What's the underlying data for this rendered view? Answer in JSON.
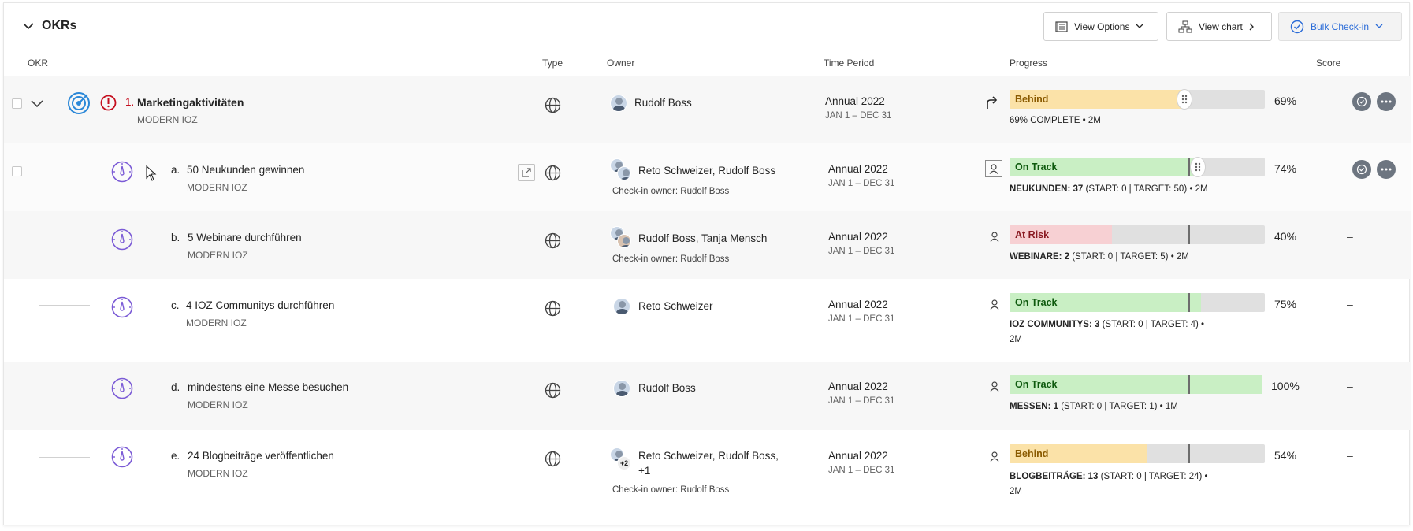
{
  "header": {
    "title": "OKRs",
    "view_options": "View Options",
    "view_chart": "View chart",
    "bulk_checkin": "Bulk Check-in"
  },
  "columns": {
    "okr": "OKR",
    "type": "Type",
    "owner": "Owner",
    "time_period": "Time Period",
    "progress": "Progress",
    "score": "Score"
  },
  "objective": {
    "index": "1.",
    "title": "Marketingaktivitäten",
    "team": "MODERN IOZ",
    "owner": "Rudolf Boss",
    "period": "Annual 2022",
    "range": "JAN 1 – DEC 31",
    "status": "Behind",
    "progress": 69,
    "percent": "69%",
    "meta": "69% COMPLETE • 2M",
    "score": "–",
    "status_color": "#fbe2a8"
  },
  "key_results": [
    {
      "letter": "a.",
      "title": "50 Neukunden gewinnen",
      "team": "MODERN IOZ",
      "owner": "Reto Schweizer, Rudolf Boss",
      "checkin_owner": "Check-in owner: Rudolf Boss",
      "period": "Annual 2022",
      "range": "JAN 1 – DEC 31",
      "status": "On Track",
      "progress": 74,
      "percent": "74%",
      "meta_key": "NEUKUNDEN: 37",
      "meta_rest": " (START: 0 | TARGET: 50) • 2M",
      "score": ""
    },
    {
      "letter": "b.",
      "title": "5 Webinare durchführen",
      "team": "MODERN IOZ",
      "owner": "Rudolf Boss, Tanja Mensch",
      "checkin_owner": "Check-in owner: Rudolf Boss",
      "period": "Annual 2022",
      "range": "JAN 1 – DEC 31",
      "status": "At Risk",
      "progress": 40,
      "percent": "40%",
      "meta_key": "WEBINARE: 2",
      "meta_rest": " (START: 0 | TARGET: 5) • 2M",
      "score": "–"
    },
    {
      "letter": "c.",
      "title": "4 IOZ Communitys durchführen",
      "team": "MODERN IOZ",
      "owner": "Reto Schweizer",
      "checkin_owner": "",
      "period": "Annual 2022",
      "range": "JAN 1 – DEC 31",
      "status": "On Track",
      "progress": 75,
      "percent": "75%",
      "meta_key": "IOZ COMMUNITYS: 3",
      "meta_rest": " (START: 0 | TARGET: 4) •",
      "meta_line2": "2M",
      "score": "–"
    },
    {
      "letter": "d.",
      "title": "mindestens eine Messe besuchen",
      "team": "MODERN IOZ",
      "owner": "Rudolf Boss",
      "checkin_owner": "",
      "period": "Annual 2022",
      "range": "JAN 1 – DEC 31",
      "status": "On Track",
      "progress": 100,
      "percent": "100%",
      "meta_key": "MESSEN: 1",
      "meta_rest": " (START: 0 | TARGET: 1) • 1M",
      "score": "–"
    },
    {
      "letter": "e.",
      "title": "24 Blogbeiträge veröffentlichen",
      "team": "MODERN IOZ",
      "owner": "Reto Schweizer, Rudolf Boss,",
      "owner_line2": "+1",
      "avatar_badge": "+2",
      "checkin_owner": "Check-in owner: Rudolf Boss",
      "period": "Annual 2022",
      "range": "JAN 1 – DEC 31",
      "status": "Behind",
      "progress": 54,
      "percent": "54%",
      "meta_key": "BLOGBEITRÄGE: 13",
      "meta_rest": " (START: 0 | TARGET: 24) •",
      "meta_line2": "2M",
      "score": "–"
    }
  ],
  "colors": {
    "on_track": "#c9efc4",
    "at_risk": "#f7d0d3",
    "behind": "#fbe2a8",
    "icon_purple": "#7b5bd6",
    "icon_blue": "#2b88d8",
    "alert_red": "#c50f1f"
  }
}
